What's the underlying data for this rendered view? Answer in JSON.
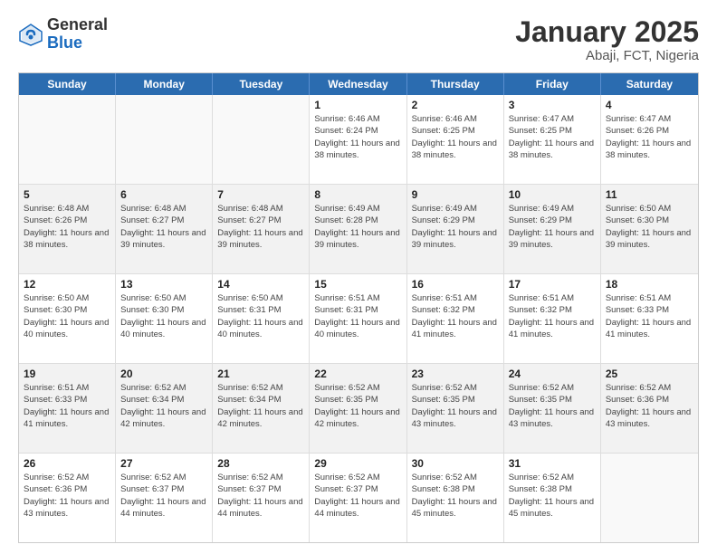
{
  "header": {
    "logo_general": "General",
    "logo_blue": "Blue",
    "title": "January 2025",
    "subtitle": "Abaji, FCT, Nigeria"
  },
  "weekdays": [
    "Sunday",
    "Monday",
    "Tuesday",
    "Wednesday",
    "Thursday",
    "Friday",
    "Saturday"
  ],
  "rows": [
    {
      "cells": [
        {
          "day": "",
          "info": ""
        },
        {
          "day": "",
          "info": ""
        },
        {
          "day": "",
          "info": ""
        },
        {
          "day": "1",
          "info": "Sunrise: 6:46 AM\nSunset: 6:24 PM\nDaylight: 11 hours\nand 38 minutes."
        },
        {
          "day": "2",
          "info": "Sunrise: 6:46 AM\nSunset: 6:25 PM\nDaylight: 11 hours\nand 38 minutes."
        },
        {
          "day": "3",
          "info": "Sunrise: 6:47 AM\nSunset: 6:25 PM\nDaylight: 11 hours\nand 38 minutes."
        },
        {
          "day": "4",
          "info": "Sunrise: 6:47 AM\nSunset: 6:26 PM\nDaylight: 11 hours\nand 38 minutes."
        }
      ]
    },
    {
      "cells": [
        {
          "day": "5",
          "info": "Sunrise: 6:48 AM\nSunset: 6:26 PM\nDaylight: 11 hours\nand 38 minutes."
        },
        {
          "day": "6",
          "info": "Sunrise: 6:48 AM\nSunset: 6:27 PM\nDaylight: 11 hours\nand 39 minutes."
        },
        {
          "day": "7",
          "info": "Sunrise: 6:48 AM\nSunset: 6:27 PM\nDaylight: 11 hours\nand 39 minutes."
        },
        {
          "day": "8",
          "info": "Sunrise: 6:49 AM\nSunset: 6:28 PM\nDaylight: 11 hours\nand 39 minutes."
        },
        {
          "day": "9",
          "info": "Sunrise: 6:49 AM\nSunset: 6:29 PM\nDaylight: 11 hours\nand 39 minutes."
        },
        {
          "day": "10",
          "info": "Sunrise: 6:49 AM\nSunset: 6:29 PM\nDaylight: 11 hours\nand 39 minutes."
        },
        {
          "day": "11",
          "info": "Sunrise: 6:50 AM\nSunset: 6:30 PM\nDaylight: 11 hours\nand 39 minutes."
        }
      ]
    },
    {
      "cells": [
        {
          "day": "12",
          "info": "Sunrise: 6:50 AM\nSunset: 6:30 PM\nDaylight: 11 hours\nand 40 minutes."
        },
        {
          "day": "13",
          "info": "Sunrise: 6:50 AM\nSunset: 6:30 PM\nDaylight: 11 hours\nand 40 minutes."
        },
        {
          "day": "14",
          "info": "Sunrise: 6:50 AM\nSunset: 6:31 PM\nDaylight: 11 hours\nand 40 minutes."
        },
        {
          "day": "15",
          "info": "Sunrise: 6:51 AM\nSunset: 6:31 PM\nDaylight: 11 hours\nand 40 minutes."
        },
        {
          "day": "16",
          "info": "Sunrise: 6:51 AM\nSunset: 6:32 PM\nDaylight: 11 hours\nand 41 minutes."
        },
        {
          "day": "17",
          "info": "Sunrise: 6:51 AM\nSunset: 6:32 PM\nDaylight: 11 hours\nand 41 minutes."
        },
        {
          "day": "18",
          "info": "Sunrise: 6:51 AM\nSunset: 6:33 PM\nDaylight: 11 hours\nand 41 minutes."
        }
      ]
    },
    {
      "cells": [
        {
          "day": "19",
          "info": "Sunrise: 6:51 AM\nSunset: 6:33 PM\nDaylight: 11 hours\nand 41 minutes."
        },
        {
          "day": "20",
          "info": "Sunrise: 6:52 AM\nSunset: 6:34 PM\nDaylight: 11 hours\nand 42 minutes."
        },
        {
          "day": "21",
          "info": "Sunrise: 6:52 AM\nSunset: 6:34 PM\nDaylight: 11 hours\nand 42 minutes."
        },
        {
          "day": "22",
          "info": "Sunrise: 6:52 AM\nSunset: 6:35 PM\nDaylight: 11 hours\nand 42 minutes."
        },
        {
          "day": "23",
          "info": "Sunrise: 6:52 AM\nSunset: 6:35 PM\nDaylight: 11 hours\nand 43 minutes."
        },
        {
          "day": "24",
          "info": "Sunrise: 6:52 AM\nSunset: 6:35 PM\nDaylight: 11 hours\nand 43 minutes."
        },
        {
          "day": "25",
          "info": "Sunrise: 6:52 AM\nSunset: 6:36 PM\nDaylight: 11 hours\nand 43 minutes."
        }
      ]
    },
    {
      "cells": [
        {
          "day": "26",
          "info": "Sunrise: 6:52 AM\nSunset: 6:36 PM\nDaylight: 11 hours\nand 43 minutes."
        },
        {
          "day": "27",
          "info": "Sunrise: 6:52 AM\nSunset: 6:37 PM\nDaylight: 11 hours\nand 44 minutes."
        },
        {
          "day": "28",
          "info": "Sunrise: 6:52 AM\nSunset: 6:37 PM\nDaylight: 11 hours\nand 44 minutes."
        },
        {
          "day": "29",
          "info": "Sunrise: 6:52 AM\nSunset: 6:37 PM\nDaylight: 11 hours\nand 44 minutes."
        },
        {
          "day": "30",
          "info": "Sunrise: 6:52 AM\nSunset: 6:38 PM\nDaylight: 11 hours\nand 45 minutes."
        },
        {
          "day": "31",
          "info": "Sunrise: 6:52 AM\nSunset: 6:38 PM\nDaylight: 11 hours\nand 45 minutes."
        },
        {
          "day": "",
          "info": ""
        }
      ]
    }
  ]
}
